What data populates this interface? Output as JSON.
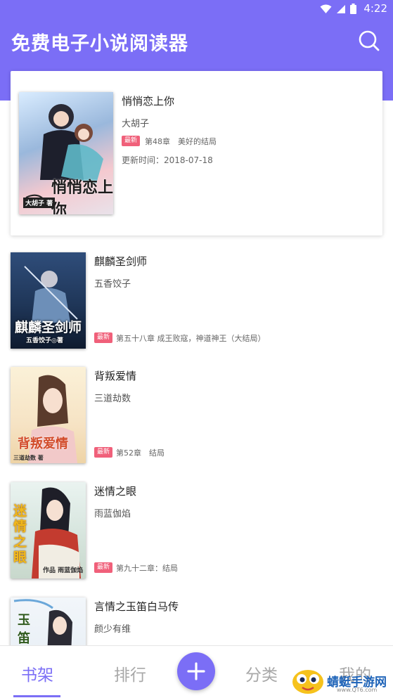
{
  "status_bar": {
    "time": "4:22"
  },
  "header": {
    "title": "免费电子小说阅读器"
  },
  "featured_book": {
    "title": "悄悄恋上你",
    "author": "大胡子",
    "badge": "最新",
    "chapter": "第48章　美好的结局",
    "update_time": "更新时间：2018-07-18",
    "cover_title": "悄悄恋上你",
    "cover_tag": "大胡子 著"
  },
  "books": [
    {
      "title": "麒麟圣剑师",
      "author": "五香饺子",
      "badge": "最新",
      "chapter": "第五十八章 成王败寇，神道神王（大结局）",
      "cover_title": "麒麟圣剑师",
      "cover_sub": "五香饺子◎著"
    },
    {
      "title": "背叛爱情",
      "author": "三道劫数",
      "badge": "最新",
      "chapter": "第52章　结局",
      "cover_title": "背叛爱情",
      "cover_sub": "三道劫数 著"
    },
    {
      "title": "迷情之眼",
      "author": "雨蓝伽焰",
      "badge": "最新",
      "chapter": "第九十二章：结局",
      "cover_title": "迷情之眼",
      "cover_sub": "作品 雨蓝伽焰"
    },
    {
      "title": "言情之玉笛白马传",
      "author": "颜少有维",
      "badge": "",
      "chapter": "",
      "cover_title": "玉笛",
      "cover_sub": ""
    }
  ],
  "bottom_nav": {
    "items": [
      {
        "label": "书架"
      },
      {
        "label": "排行"
      },
      {
        "label": "分类"
      },
      {
        "label": "我的"
      }
    ]
  },
  "watermark": {
    "text": "蜻蜓手游网",
    "url": "www.QT6.com"
  },
  "colors": {
    "accent": "#7b6ef6",
    "badge": "#f0607a"
  }
}
